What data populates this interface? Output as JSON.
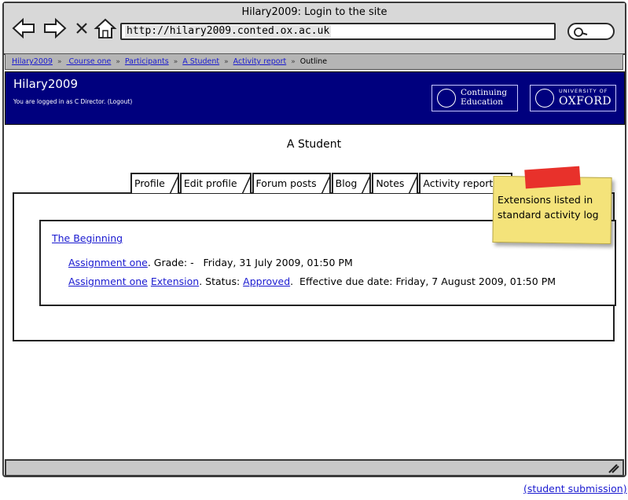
{
  "window": {
    "title": "Hilary2009: Login to the site",
    "address": "http://hilary2009.conted.ox.ac.uk",
    "icons": [
      "back-arrow-icon",
      "forward-arrow-icon",
      "close-x-icon",
      "home-icon",
      "search-icon"
    ]
  },
  "breadcrumb": {
    "items": [
      "Hilary2009",
      " Course one",
      "Participants",
      "A Student",
      "Activity report"
    ],
    "current": "Outline",
    "separator": "»"
  },
  "header": {
    "site_name": "Hilary2009",
    "login_info": "You are logged in as C Director. (Logout)",
    "logo_ce": "Continuing Education",
    "logo_ox_small": "UNIVERSITY OF",
    "logo_ox_big": "OXFORD",
    "background": "#00007e"
  },
  "page": {
    "student_name": "A Student",
    "tabs": [
      "Profile",
      "Edit profile",
      "Forum posts",
      "Blog",
      "Notes",
      "Activity reports"
    ]
  },
  "report": {
    "section_title": "The Beginning",
    "line1": {
      "link": "Assignment one",
      "text": ". Grade: -   Friday, 31 July 2009, 01:50 PM"
    },
    "line2": {
      "link1": "Assignment one",
      "link2": "Extension",
      "text1": ". Status: ",
      "link3": "Approved",
      "text2": ".  Effective due date: Friday, 7 August 2009, 01:50 PM"
    }
  },
  "note": {
    "text": "Extensions listed in standard activity log",
    "color": "#f4e37a",
    "tape_color": "#e8312b"
  },
  "footer": {
    "link": "(student submission)"
  }
}
